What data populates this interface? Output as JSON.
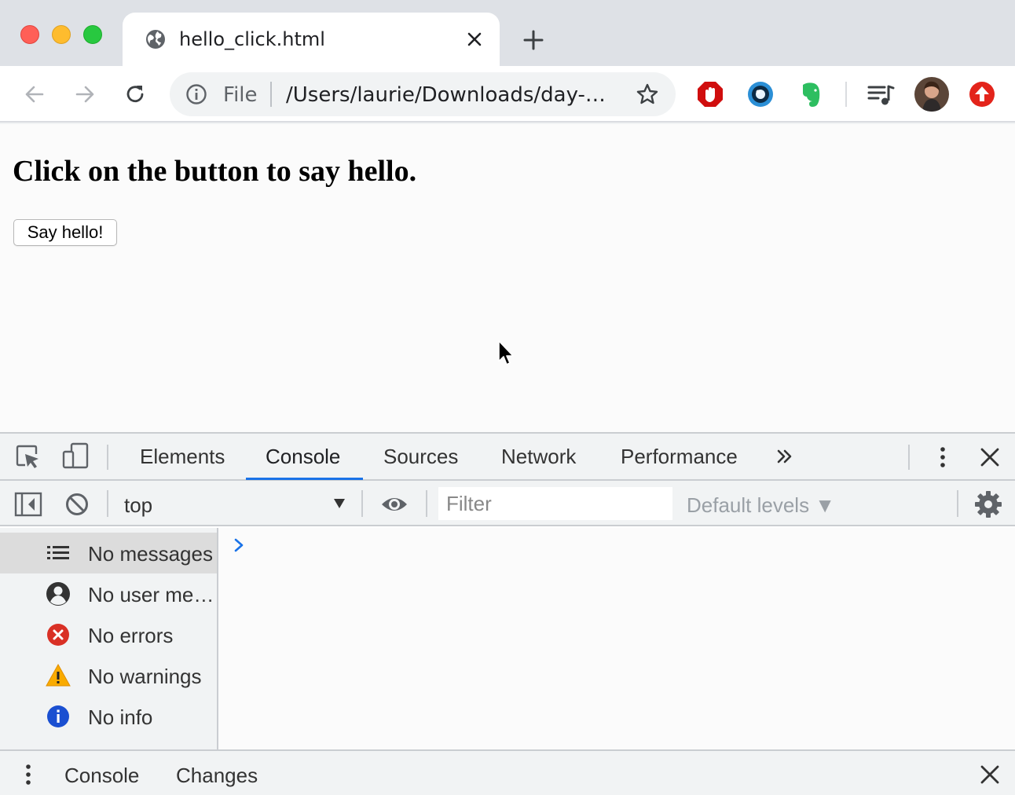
{
  "window": {
    "tab": {
      "title": "hello_click.html",
      "icon": "globe-icon"
    }
  },
  "toolbar": {
    "omnibox": {
      "scheme_label": "File",
      "url": "/Users/laurie/Downloads/day-…"
    },
    "extensions": [
      "adblock-icon",
      "eye-extension-icon",
      "evernote-icon",
      "media-controls-icon",
      "profile-avatar",
      "update-icon"
    ]
  },
  "page": {
    "heading": "Click on the button to say hello.",
    "button_label": "Say hello!"
  },
  "devtools": {
    "tabs": [
      "Elements",
      "Console",
      "Sources",
      "Network",
      "Performance"
    ],
    "active_tab": "Console",
    "context": "top",
    "filter_placeholder": "Filter",
    "levels": "Default levels ▼",
    "sidebar": [
      {
        "label": "No messages",
        "icon": "list-icon"
      },
      {
        "label": "No user me…",
        "icon": "user-icon"
      },
      {
        "label": "No errors",
        "icon": "error-icon"
      },
      {
        "label": "No warnings",
        "icon": "warning-icon"
      },
      {
        "label": "No info",
        "icon": "info-icon"
      }
    ],
    "drawer_tabs": [
      "Console",
      "Changes"
    ]
  },
  "colors": {
    "accent": "#1a73e8",
    "error": "#d93025",
    "warning": "#f9ab00",
    "info": "#1a4fd1"
  }
}
